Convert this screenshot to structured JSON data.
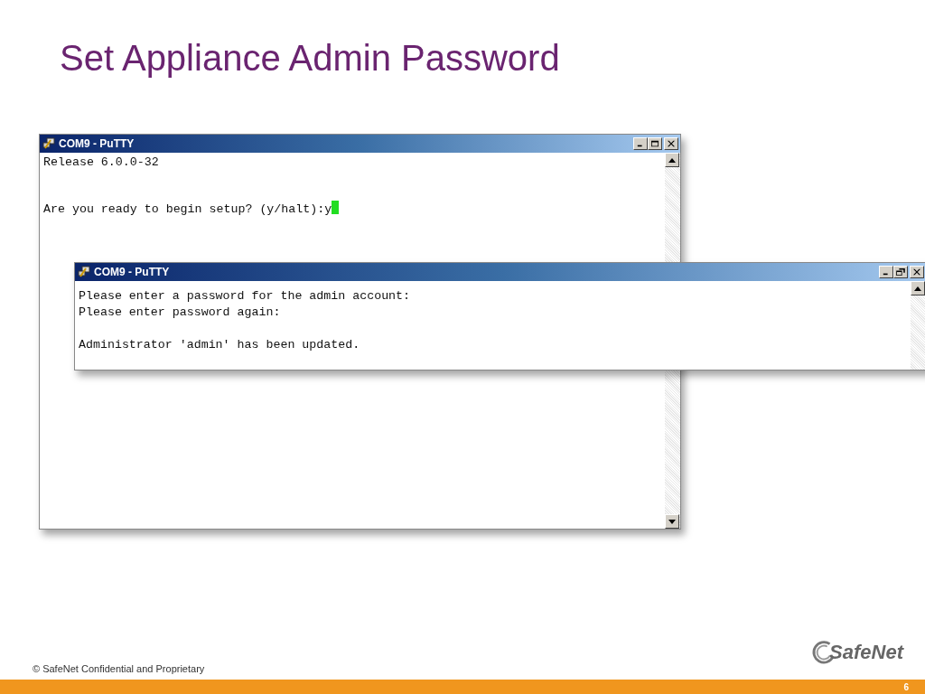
{
  "slide": {
    "title": "Set Appliance Admin Password"
  },
  "windows": [
    {
      "title": "COM9 - PuTTY",
      "maximized": false,
      "cursor": true,
      "paragraphs": [
        [
          "Release 6.0.0-32"
        ],
        [
          "Are you ready to begin setup? (y/halt):y"
        ]
      ]
    },
    {
      "title": "COM9 - PuTTY",
      "maximized": true,
      "cursor": false,
      "paragraphs": [
        [
          "Please enter a password for the admin account:",
          "Please enter password again:"
        ],
        [
          "Administrator 'admin' has been updated."
        ]
      ]
    }
  ],
  "footer": {
    "copyright": "© SafeNet Confidential and Proprietary",
    "logo": "SafeNet",
    "page_number": "6"
  }
}
